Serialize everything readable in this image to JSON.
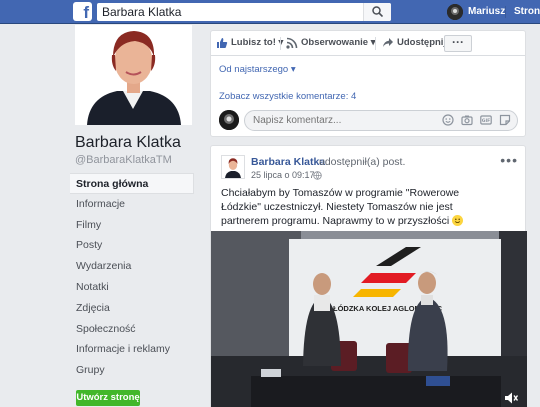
{
  "topbar": {
    "logo": "f",
    "search_value": "Barbara Klatka",
    "search_icon": "search-icon",
    "user_name": "Mariusz",
    "home_link": "Strona"
  },
  "profile": {
    "name": "Barbara Klatka",
    "handle": "@BarbaraKlatkaTM"
  },
  "nav": {
    "items": [
      {
        "label": "Strona główna"
      },
      {
        "label": "Informacje"
      },
      {
        "label": "Filmy"
      },
      {
        "label": "Posty"
      },
      {
        "label": "Wydarzenia"
      },
      {
        "label": "Notatki"
      },
      {
        "label": "Zdjęcia"
      },
      {
        "label": "Społeczność"
      },
      {
        "label": "Informacje i reklamy"
      },
      {
        "label": "Grupy"
      }
    ],
    "create_page": "Utwórz stronę"
  },
  "actions": {
    "like": "Lubisz to!",
    "follow": "Obserwowanie",
    "share": "Udostępnij",
    "more": "···"
  },
  "comments": {
    "sort": "Od najstarszego",
    "view_all": "Zobacz wszystkie komentarze: 4",
    "placeholder": "Napisz komentarz..."
  },
  "post": {
    "author": "Barbara Klatka",
    "action": "udostępnił(a) post.",
    "time": "25 lipca o 09:17 ·",
    "text": "Chciałabym by Tomaszów w programie \"Rowerowe Łódzkie\" uczestniczył. Niestety Tomaszów nie jest partnerem programu. Naprawmy to w przyszłości",
    "photo_banner": "ŁÓDZKA KOLEJ AGLOMERAC"
  },
  "colors": {
    "facebook_blue": "#4267b2",
    "link_blue": "#385898",
    "create_green": "#42b72a"
  }
}
